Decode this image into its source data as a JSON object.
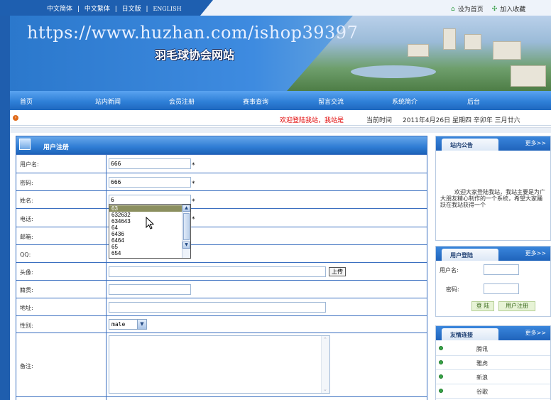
{
  "top": {
    "languages": [
      "中文简体",
      "中文繁体",
      "日文版",
      "ENGLISH"
    ],
    "lang_separator": "|",
    "set_home": "设为首页",
    "add_favorite": "加入收藏"
  },
  "banner": {
    "url": "https://www.huzhan.com/ishop39397",
    "site_title": "羽毛球协会网站"
  },
  "nav": {
    "items": [
      "首页",
      "站内新闻",
      "会员注册",
      "赛事查询",
      "留言交流",
      "系统简介",
      "后台"
    ]
  },
  "welcome": {
    "message": "欢迎登陆我站，我站是",
    "time_label": "当前时间",
    "date": "2011年4月26日 星期四 辛卯年 三月廿六"
  },
  "form": {
    "title": "用户注册",
    "required_mark": "*",
    "username": {
      "label": "用户名:",
      "value": "666"
    },
    "password": {
      "label": "密码:",
      "value": "666"
    },
    "name": {
      "label": "姓名:",
      "value": "6"
    },
    "phone": {
      "label": "电话:"
    },
    "email": {
      "label": "邮箱:"
    },
    "qq": {
      "label": "QQ:"
    },
    "avatar": {
      "label": "头像:",
      "upload_label": "上传"
    },
    "hometown": {
      "label": "籍贯:"
    },
    "address": {
      "label": "地址:"
    },
    "gender": {
      "label": "性别:",
      "value": "male"
    },
    "remark": {
      "label": "备注:"
    }
  },
  "autocomplete": {
    "options": [
      "63",
      "632632",
      "634643",
      "64",
      "6436",
      "6464",
      "65",
      "654"
    ],
    "selected": 0
  },
  "sidebar": {
    "more": "更多>>",
    "notice": {
      "title": "站内公告",
      "text": "欢迎大家登陆我站，我站主要是为广大朋友精心制作的一个系统，希望大家踊跃在我站获得一个"
    },
    "login": {
      "title": "用户登陆",
      "username_label": "用户名:",
      "password_label": "密码:",
      "login_button": "登 陆",
      "register_button": "用户注册"
    },
    "links": {
      "title": "友情连接",
      "items": [
        "腾讯",
        "雅虎",
        "新浪",
        "谷歌"
      ]
    }
  }
}
